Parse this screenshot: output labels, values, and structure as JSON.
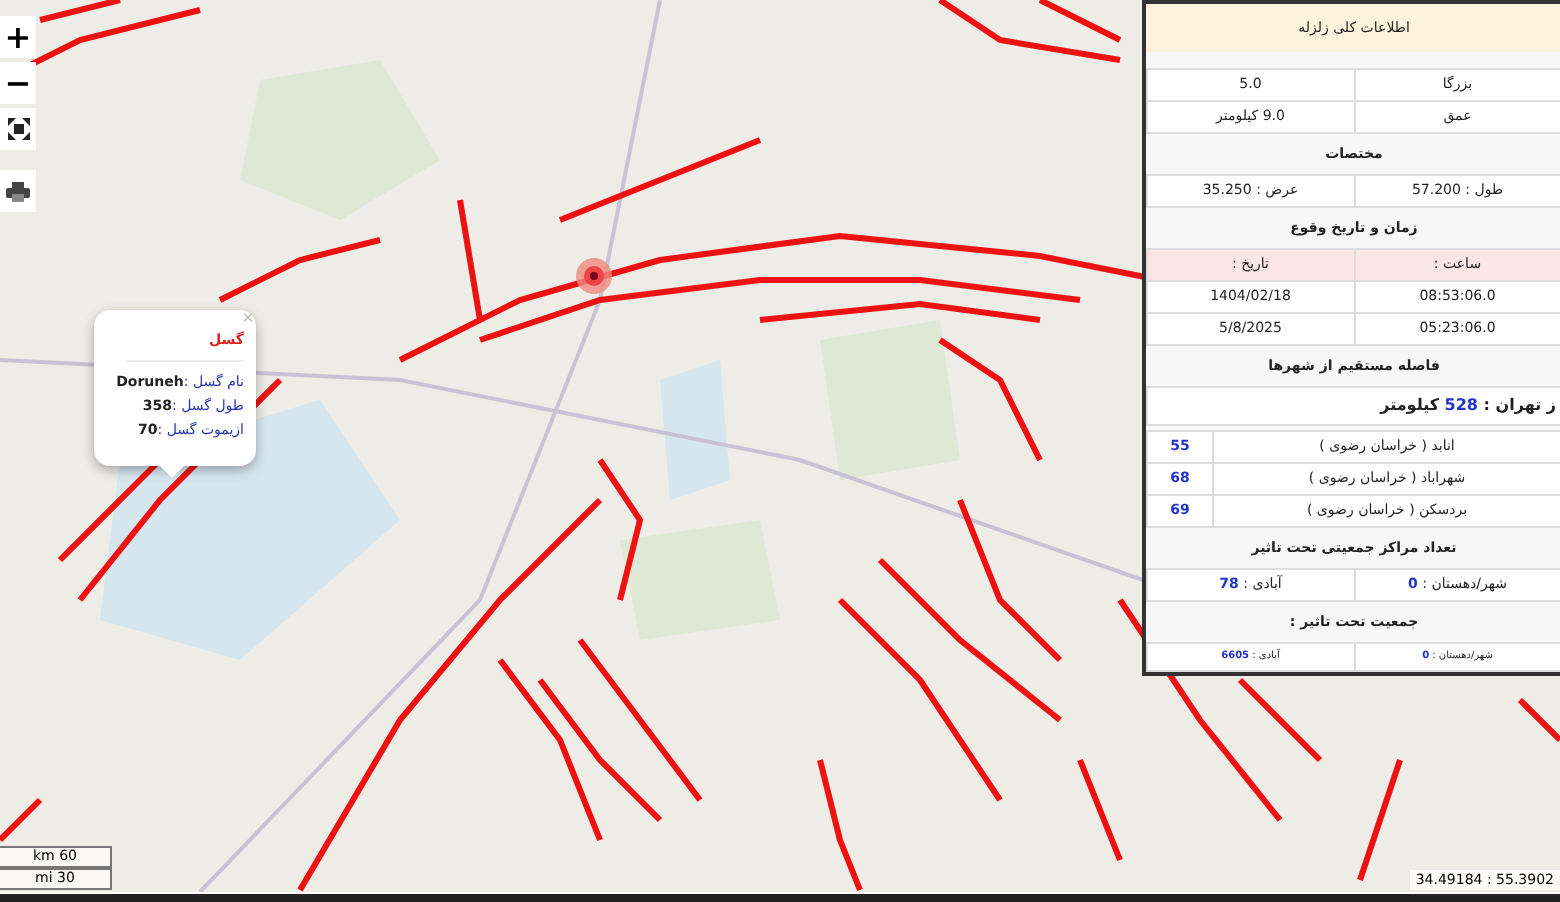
{
  "map_controls": {
    "zoom_in": "+",
    "zoom_out": "−"
  },
  "popup": {
    "close": "×",
    "title": "گسل",
    "fields": [
      {
        "label": "نام گسل :",
        "value": "Doruneh"
      },
      {
        "label": "طول گسل :",
        "value": "358"
      },
      {
        "label": "ازیموت گسل :",
        "value": "70"
      }
    ]
  },
  "scale": {
    "metric": "km 60",
    "imperial": "mi 30"
  },
  "coordinates": "34.49184 : 55.3902",
  "panel": {
    "title": "اطلاعات کلی زلزله",
    "basic": [
      {
        "label": "بزرگا",
        "value": "5.0"
      },
      {
        "label": "عمق",
        "value": "9.0 کیلومتر"
      }
    ],
    "coords_heading": "مختصات",
    "coords": [
      "طول : 57.200",
      "عرض : 35.250"
    ],
    "time_heading": "زمان و تاریخ وقوع",
    "time_columns": [
      "ساعت :",
      "تاریخ :"
    ],
    "time_rows": [
      [
        "08:53:06.0",
        "1404/02/18"
      ],
      [
        "05:23:06.0",
        "5/8/2025"
      ]
    ],
    "distance_heading": "فاصله مستقیم از شهرها",
    "capital": {
      "label": "ز تهران :",
      "value": "528",
      "unit": "کیلومتر"
    },
    "cities": [
      {
        "name": "انابد ( خراسان رضوی )",
        "distance": "55"
      },
      {
        "name": "شهراباد ( خراسان رضوی )",
        "distance": "68"
      },
      {
        "name": "بردسکن ( خراسان رضوی )",
        "distance": "69"
      }
    ],
    "centers_heading": "تعداد مراکز جمعیتی تحت تاثیر",
    "centers": [
      {
        "label": "شهر/دهستان :",
        "value": "0"
      },
      {
        "label": "آبادی :",
        "value": "78"
      }
    ],
    "population_heading": "جمعیت تحت تاثیر :",
    "population": [
      {
        "label": "شهر/دهستان :",
        "value": "0"
      },
      {
        "label": "آبادی :",
        "value": "6605"
      }
    ]
  }
}
